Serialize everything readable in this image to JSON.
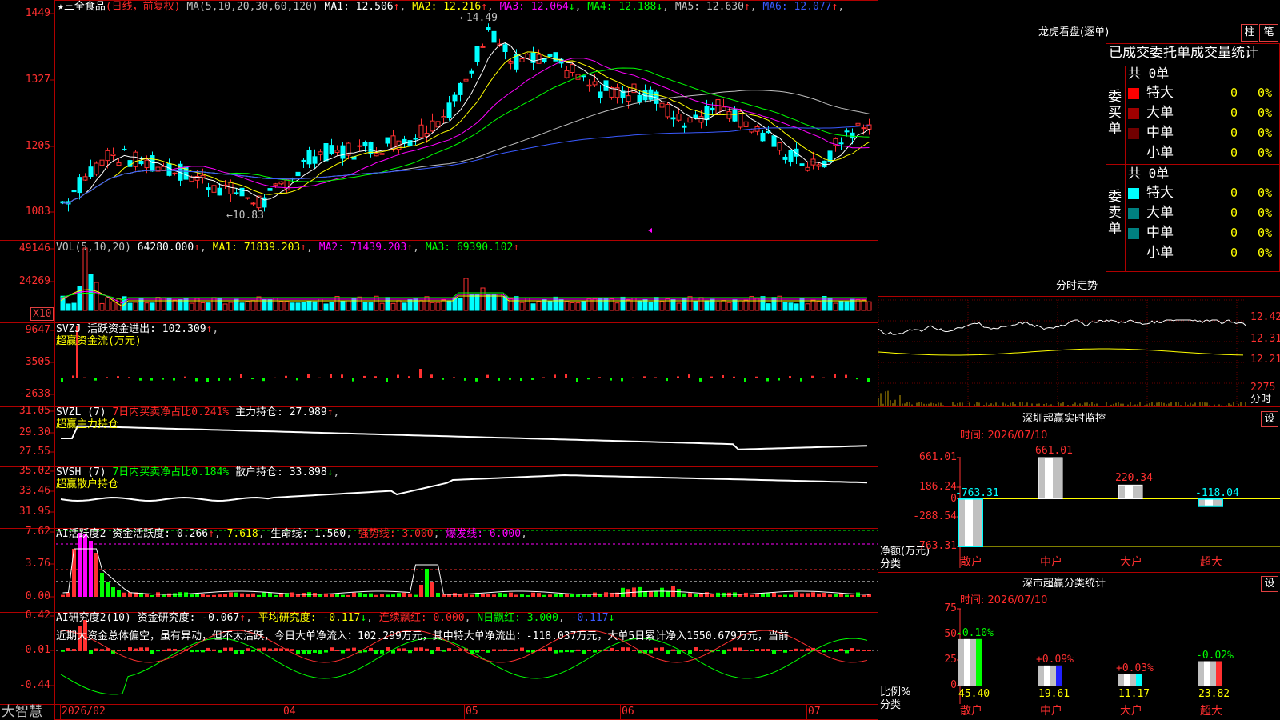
{
  "stock": {
    "name": "★三全食品",
    "period": "(日线，前复权)",
    "ma_line": {
      "prefix": "MA(5,10,20,30,60,120)",
      "items": [
        {
          "label": "MA1: 12.506",
          "arrow": "↑",
          "color": "#ffffff"
        },
        {
          "label": "MA2: 12.216",
          "arrow": "↑",
          "color": "#ffff00"
        },
        {
          "label": "MA3: 12.064",
          "arrow": "↓",
          "color": "#ff00ff"
        },
        {
          "label": "MA4: 12.188",
          "arrow": "↓",
          "color": "#00ff00"
        },
        {
          "label": "MA5: 12.630",
          "arrow": "↑",
          "color": "#c0c0c0"
        },
        {
          "label": "MA6: 12.077",
          "arrow": "↑",
          "color": "#3a5aff"
        }
      ]
    },
    "high_label": "14.49",
    "low_label": "10.83",
    "axis": [
      "1449",
      "1327",
      "1205",
      "1083"
    ]
  },
  "vol": {
    "prefix": "VOL(5,10,20)",
    "value": "64280.000",
    "items": [
      {
        "label": "MA1: 71839.203",
        "arrow": "↑",
        "color": "#ffff00"
      },
      {
        "label": "MA2: 71439.203",
        "arrow": "↑",
        "color": "#ff00ff"
      },
      {
        "label": "MA3: 69390.102",
        "arrow": "↑",
        "color": "#00ff00"
      }
    ],
    "axis": [
      "49146",
      "24269"
    ],
    "unit": "X10"
  },
  "svzj": {
    "line1": "SVZJ  活跃资金进出: 102.309",
    "arrow": "↑",
    "line2": "超赢资金流(万元)",
    "axis": [
      "9647",
      "3505",
      "-2638"
    ]
  },
  "svzl": {
    "name": "SVZL (7)",
    "red": "7日内买卖净占比0.241%",
    "main": "主力持仓: 27.989",
    "arrow": "↑",
    "line2": "超赢主力持仓",
    "axis": [
      "31.05",
      "29.30",
      "27.55"
    ]
  },
  "svsh": {
    "name": "SVSH (7)",
    "green": "7日内买卖净占比0.184%",
    "main": "散户持仓: 33.898",
    "arrow": "↓",
    "line2": "超赢散户持仓",
    "axis": [
      "35.02",
      "33.46",
      "31.95"
    ]
  },
  "ai1": {
    "text": "AI活跃度2 资金活跃度: 0.266",
    "v2": "7.618",
    "v3": "生命线: 1.560",
    "v4": "强势线: 3.000",
    "v5": "爆发线: 6.000",
    "axis": [
      "7.62",
      "3.76",
      "0.00"
    ]
  },
  "ai2": {
    "prefix": "AI研究度2(10) 资金研究度: -0.067",
    "avg": "平均研究度: -0.117",
    "lxph": "连续飘红: 0.000",
    "nph": "N日飘红: 3.000",
    "last": "-0.117",
    "desc": "近期大资金总体偏空，虽有异动，但不太活跃，今日大单净流入：102.299万元，其中特大单净流出：-118.037万元，大单5日累计净入1550.679万元，当前",
    "axis": [
      "0.42",
      "-0.01",
      "-0.44"
    ]
  },
  "xaxis": {
    "brand": "大智慧",
    "labels": [
      "2026/02",
      "04",
      "05",
      "06",
      "07"
    ]
  },
  "right": {
    "lhkp_title": "龙虎看盘(逐单)",
    "btn_zhu": "柱",
    "btn_bi": "笔",
    "tab_title": "已成交委托单成交量统计",
    "buy": {
      "side": "委买单",
      "total": "共 0单",
      "rows": [
        {
          "label": "特大",
          "v": "0",
          "p": "0%",
          "color": "#ff0000"
        },
        {
          "label": "大单",
          "v": "0",
          "p": "0%",
          "color": "#a00000"
        },
        {
          "label": "中单",
          "v": "0",
          "p": "0%",
          "color": "#700000"
        },
        {
          "label": "小单",
          "v": "0",
          "p": "0%",
          "color": ""
        }
      ]
    },
    "sell": {
      "side": "委卖单",
      "total": "共 0单",
      "rows": [
        {
          "label": "特大",
          "v": "0",
          "p": "0%",
          "color": "#00ffff"
        },
        {
          "label": "大单",
          "v": "0",
          "p": "0%",
          "color": "#008080"
        },
        {
          "label": "中单",
          "v": "0",
          "p": "0%",
          "color": "#008080"
        },
        {
          "label": "小单",
          "v": "0",
          "p": "0%",
          "color": ""
        }
      ]
    },
    "fs_title": "分时走势",
    "fs_axis": [
      "12.42",
      "12.31",
      "12.21",
      "2275",
      "分时"
    ],
    "monitor": {
      "title": "深圳超赢实时监控",
      "btn": "设",
      "time": "时间: 2026/07/10",
      "axis": [
        "661.01",
        "186.24",
        "0",
        "-288.54",
        "-763.31"
      ],
      "ylabel1": "净额(万元)",
      "ylabel2": "分类",
      "bars": [
        {
          "cat": "散户",
          "value": -763.31,
          "label": "-763.31"
        },
        {
          "cat": "中户",
          "value": 661.01,
          "label": "661.01"
        },
        {
          "cat": "大户",
          "value": 220.34,
          "label": "220.34"
        },
        {
          "cat": "超大",
          "value": -118.04,
          "label": "-118.04"
        }
      ]
    },
    "stats": {
      "title": "深市超赢分类统计",
      "btn": "设",
      "time": "时间: 2026/07/10",
      "axis": [
        "75",
        "50",
        "25",
        "0"
      ],
      "ylabel1": "比例%",
      "ylabel2": "分类",
      "bars": [
        {
          "cat": "散户",
          "value": 45.4,
          "label": "45.40",
          "change": "-0.10%",
          "color": "#00ff00"
        },
        {
          "cat": "中户",
          "value": 19.61,
          "label": "19.61",
          "change": "+0.09%",
          "color": "#2020ff"
        },
        {
          "cat": "大户",
          "value": 11.17,
          "label": "11.17",
          "change": "+0.03%",
          "color": "#00ffff"
        },
        {
          "cat": "超大",
          "value": 23.82,
          "label": "23.82",
          "change": "-0.02%",
          "color": "#ff3030"
        }
      ]
    }
  },
  "chart_data": {
    "type": "bar",
    "categories": [
      "散户",
      "中户",
      "大户",
      "超大"
    ],
    "series": [
      {
        "name": "净额(万元)",
        "values": [
          -763.31,
          661.01,
          220.34,
          -118.04
        ]
      },
      {
        "name": "比例%",
        "values": [
          45.4,
          19.61,
          11.17,
          23.82
        ]
      }
    ],
    "ylim": [
      -763.31,
      661.01
    ]
  }
}
